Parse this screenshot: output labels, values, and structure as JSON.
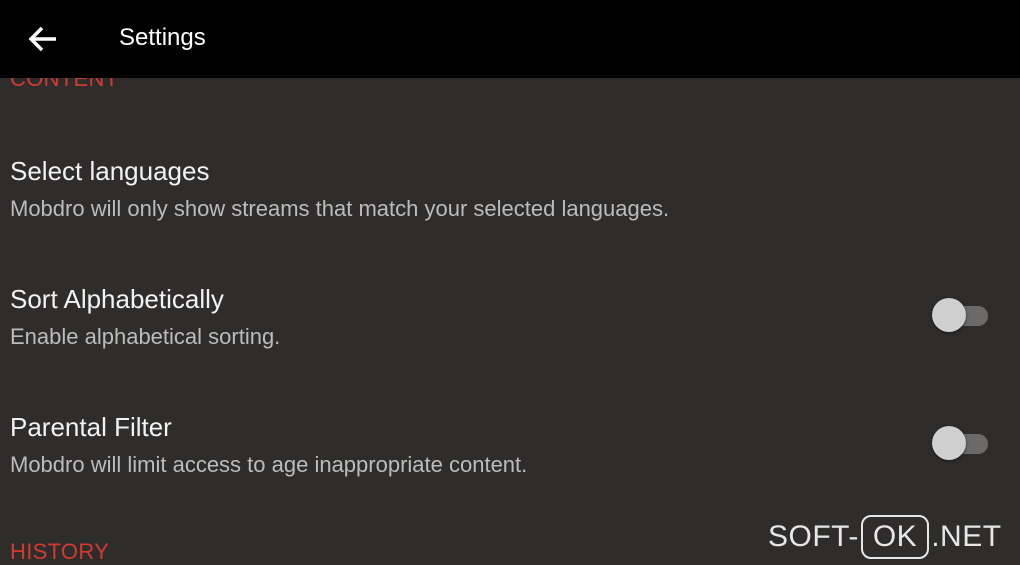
{
  "appbar": {
    "title": "Settings",
    "back_icon": "arrow-left-icon"
  },
  "sections": {
    "content_header": "CONTENT",
    "history_header": "HISTORY"
  },
  "preferences": [
    {
      "title": "Select languages",
      "summary": "Mobdro will only show streams that match your selected languages."
    },
    {
      "title": "Sort Alphabetically",
      "summary": "Enable alphabetical sorting.",
      "toggle_on": false
    },
    {
      "title": "Parental Filter",
      "summary": "Mobdro will limit access to age inappropriate content.",
      "toggle_on": false
    }
  ],
  "watermark": {
    "prefix": "SOFT-",
    "boxed": "OK",
    "suffix": ".NET"
  },
  "colors": {
    "background": "#2f2d2c",
    "appbar": "#000000",
    "accent": "#d23a2f",
    "title_text": "#f2f2f2",
    "summary_text": "#bcbcbc"
  }
}
